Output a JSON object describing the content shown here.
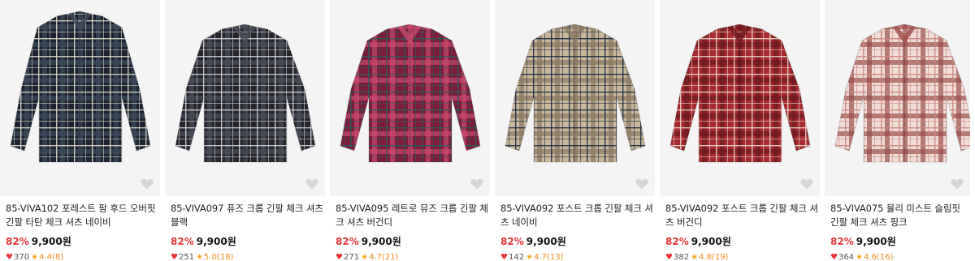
{
  "products": [
    {
      "title": "85-VIVA102 포레스트 팜 후드 오버핏 긴팔 타탄 체크 셔츠 네이비",
      "discount": "82%",
      "price": "9,900원",
      "likes": "370",
      "rating": "4.4(8)",
      "colors": {
        "base": "#1c2330",
        "line1": "#d9d6c8",
        "line2": "#3e4a5c"
      }
    },
    {
      "title": "85-VIVA097 퓨즈 크롭 긴팔 체크 셔츠 블랙",
      "discount": "82%",
      "price": "9,900원",
      "likes": "251",
      "rating": "5.0(18)",
      "colors": {
        "base": "#24262c",
        "line1": "#cfd0d6",
        "line2": "#4b4e59"
      }
    },
    {
      "title": "85-VIVA095 레트로 뮤즈 크롭 긴팔 체크 셔츠 버건디",
      "discount": "82%",
      "price": "9,900원",
      "likes": "271",
      "rating": "4.7(21)",
      "colors": {
        "base": "#7a1c3a",
        "line1": "#2f5a5a",
        "line2": "#c94a6e"
      }
    },
    {
      "title": "85-VIVA092 포스트 크롭 긴팔 체크 셔츠 네이비",
      "discount": "82%",
      "price": "9,900원",
      "likes": "142",
      "rating": "4.7(13)",
      "colors": {
        "base": "#c9b99a",
        "line1": "#1e2a44",
        "line2": "#8a7a62"
      }
    },
    {
      "title": "85-VIVA092 포스트 크롭 긴팔 체크 셔츠 버건디",
      "discount": "82%",
      "price": "9,900원",
      "likes": "382",
      "rating": "4.8(19)",
      "colors": {
        "base": "#a62a30",
        "line1": "#e9d4c4",
        "line2": "#6e1a20"
      }
    },
    {
      "title": "85-VIVA075 뮬리 미스트 슬림핏 긴팔 체크 셔츠 핑크",
      "discount": "82%",
      "price": "9,900원",
      "likes": "364",
      "rating": "4.6(16)",
      "colors": {
        "base": "#f1dcd6",
        "line1": "#c9857f",
        "line2": "#9c4e4a"
      }
    }
  ]
}
